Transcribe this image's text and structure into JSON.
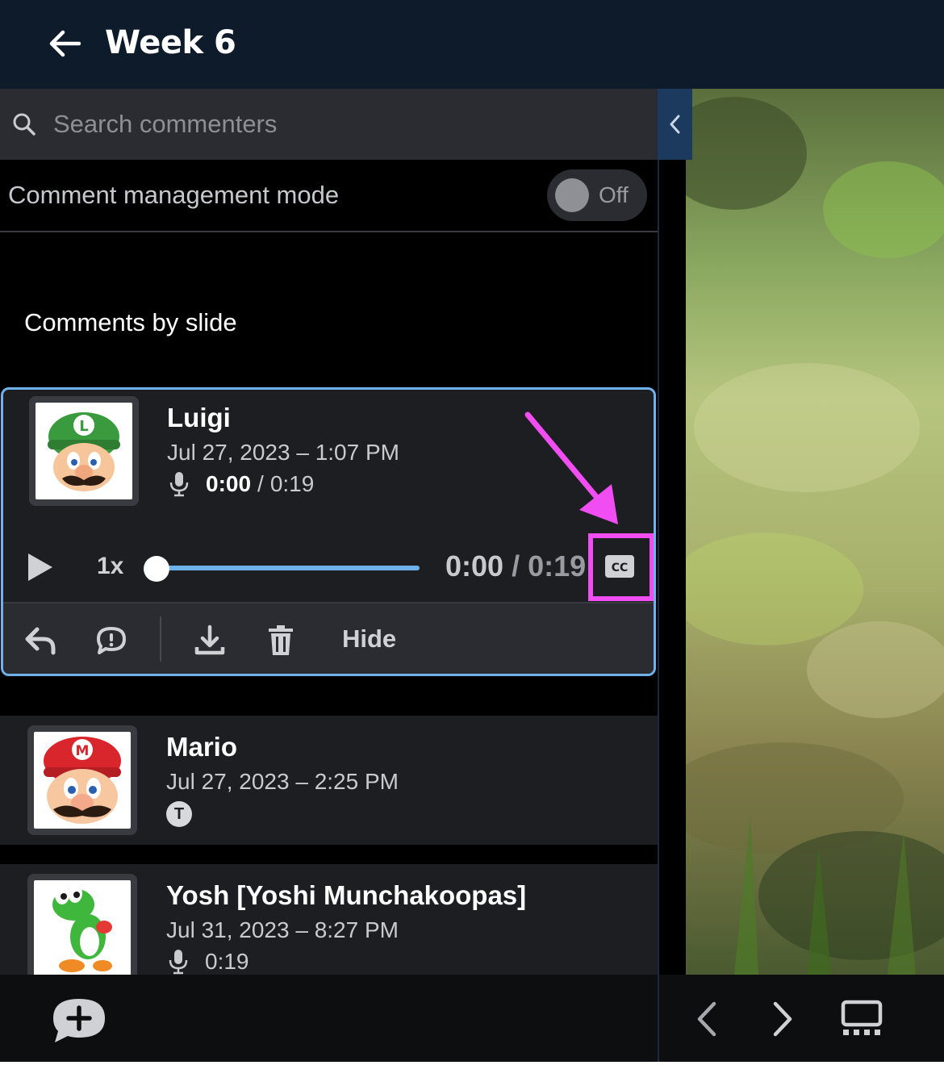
{
  "header": {
    "title": "Week 6"
  },
  "search": {
    "placeholder": "Search commenters"
  },
  "mode": {
    "label": "Comment management mode",
    "state": "Off"
  },
  "section": {
    "title": "Comments by slide"
  },
  "comments": [
    {
      "name": "Luigi",
      "date": "Jul 27, 2023 – 1:07 PM",
      "type": "audio",
      "elapsed": "0:00",
      "separator": "/",
      "duration": "0:19",
      "speed": "1x",
      "progress": 0.0,
      "actions": {
        "hide": "Hide"
      },
      "icons": [
        "reply-icon",
        "comment-bubble-icon",
        "download-icon",
        "trash-icon",
        "closed-captions-icon"
      ]
    },
    {
      "name": "Mario",
      "date": "Jul 27, 2023 – 2:25 PM",
      "type": "text",
      "badge": "T"
    },
    {
      "name": "Yosh [Yoshi Munchakoopas]",
      "date": "Jul 31, 2023 – 8:27 PM",
      "type": "audio",
      "duration": "0:19"
    }
  ],
  "player": {
    "cc_label": "CC"
  },
  "colors": {
    "header_bg": "#0d1b2a",
    "accent": "#6fb1ea",
    "highlight": "#f04df2",
    "card_bg": "#1d1e22"
  }
}
